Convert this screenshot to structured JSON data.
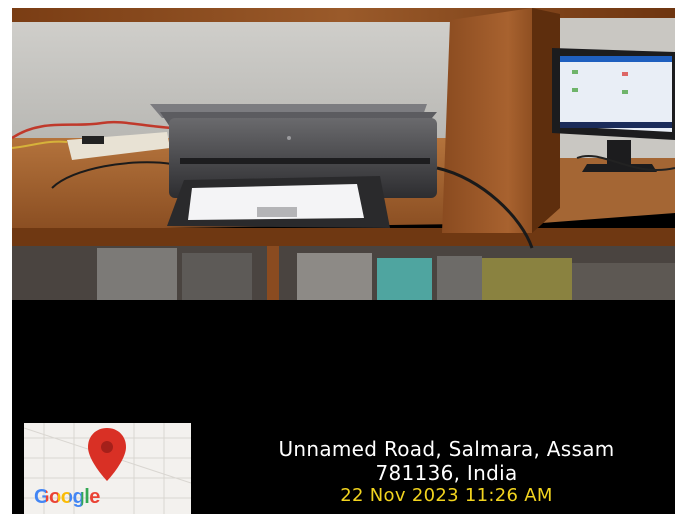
{
  "overlay": {
    "address_line1": "Unnamed Road, Salmara, Assam",
    "address_line2": "781136, India",
    "timestamp": "22 Nov 2023 11:26 AM",
    "map_logo": "Google",
    "pin_icon": "map-pin-icon"
  },
  "colors": {
    "timestamp": "#f2d41f",
    "pin": "#d93025",
    "background": "#000000"
  }
}
